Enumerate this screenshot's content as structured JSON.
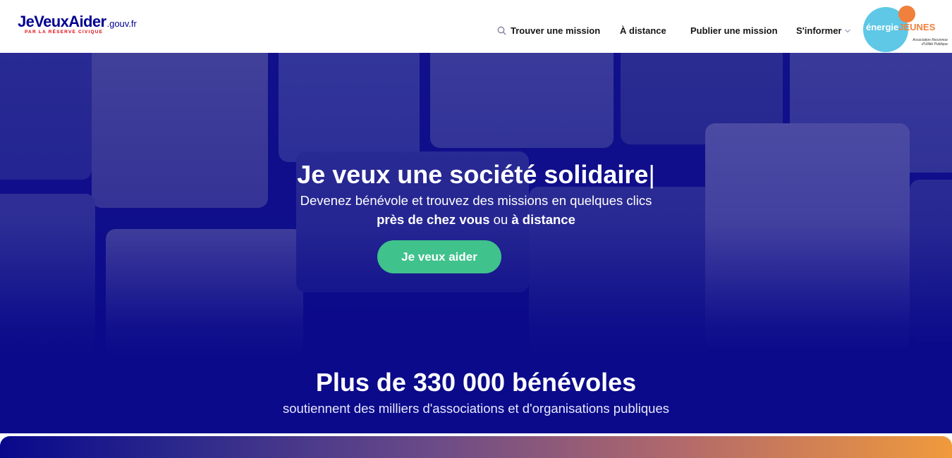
{
  "brand": {
    "name": "JeVeuxAider",
    "domain": ".gouv.fr",
    "tagline": "PAR LA RÉSERVE CIVIQUE",
    "primary_color": "#000091",
    "tagline_color": "#e1000f"
  },
  "nav": {
    "items": [
      {
        "label": "Trouver une mission",
        "icon": "search-icon"
      },
      {
        "label": "À distance"
      },
      {
        "label": "Publier une mission"
      },
      {
        "label": "S'informer",
        "icon": "chevron-down-icon"
      }
    ]
  },
  "partner": {
    "word1": "énergie",
    "word2": "JEUNES",
    "sub": "Association Reconnue d'Utilité Publique",
    "circle_color": "#5ec8e6",
    "accent_color": "#f0803c"
  },
  "hero": {
    "title": "Je veux une société solidaire",
    "cursor": "|",
    "subtitle_line1": "Devenez bénévole et trouvez des missions en quelques clics",
    "subtitle_bold1": "près de chez vous",
    "subtitle_connector": " ou ",
    "subtitle_bold2": "à distance",
    "cta_label": "Je veux aider",
    "cta_color": "#3fc28b",
    "background_color": "#0b0a8a"
  },
  "stats": {
    "title": "Plus de 330 000 bénévoles",
    "subtitle": "soutiennent des milliers d'associations et d'organisations publiques"
  }
}
